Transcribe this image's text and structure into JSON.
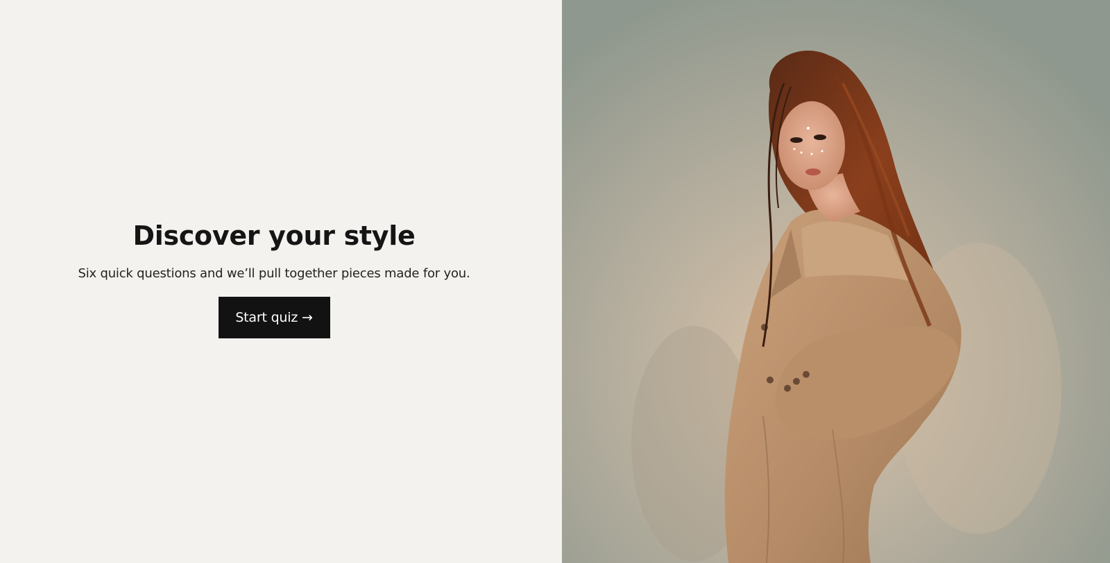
{
  "hero": {
    "title": "Discover your style",
    "subtitle": "Six quick questions and we’ll pull together pieces made for you.",
    "cta_label": "Start quiz →"
  },
  "photo": {
    "subject": "model-in-beige-oversized-coat"
  },
  "colors": {
    "page_background": "#f3f2ee",
    "button_background": "#121212",
    "button_text": "#ffffff",
    "heading_text": "#151515"
  }
}
